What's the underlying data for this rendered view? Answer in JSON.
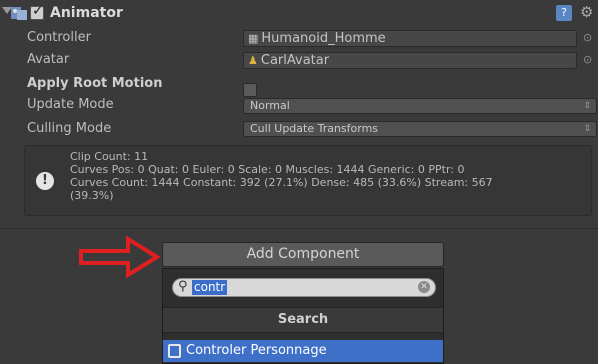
{
  "component": {
    "title": "Animator",
    "enabled": true,
    "fields": {
      "controller_label": "Controller",
      "controller_value": "Humanoid_Homme",
      "avatar_label": "Avatar",
      "avatar_value": "CarlAvatar",
      "apply_root_motion_label": "Apply Root Motion",
      "update_mode_label": "Update Mode",
      "update_mode_value": "Normal",
      "culling_mode_label": "Culling Mode",
      "culling_mode_value": "Cull Update Transforms"
    }
  },
  "info": {
    "line1": "Clip Count: 11",
    "line2": "Curves Pos: 0 Quat: 0 Euler: 0 Scale: 0 Muscles: 1444 Generic: 0 PPtr: 0",
    "line3": "Curves Count: 1444 Constant: 392 (27.1%) Dense: 485 (33.6%) Stream: 567",
    "line4": "(39.3%)"
  },
  "add_component": {
    "button_label": "Add Component",
    "search_value": "contr",
    "section_header": "Search",
    "results": [
      {
        "label": "Controler Personnage"
      }
    ]
  },
  "colors": {
    "panel_bg": "#3a3a3a",
    "selection": "#3e70c8",
    "annotation_arrow": "#e02020"
  },
  "icons": {
    "foldout": "triangle-down-icon",
    "component": "animator-icon",
    "help": "help-book-icon",
    "settings": "gear-icon",
    "info": "exclamation-icon",
    "search": "magnifier-icon",
    "clear": "clear-x-icon",
    "script": "script-file-icon",
    "annotation": "red-arrow-icon"
  }
}
